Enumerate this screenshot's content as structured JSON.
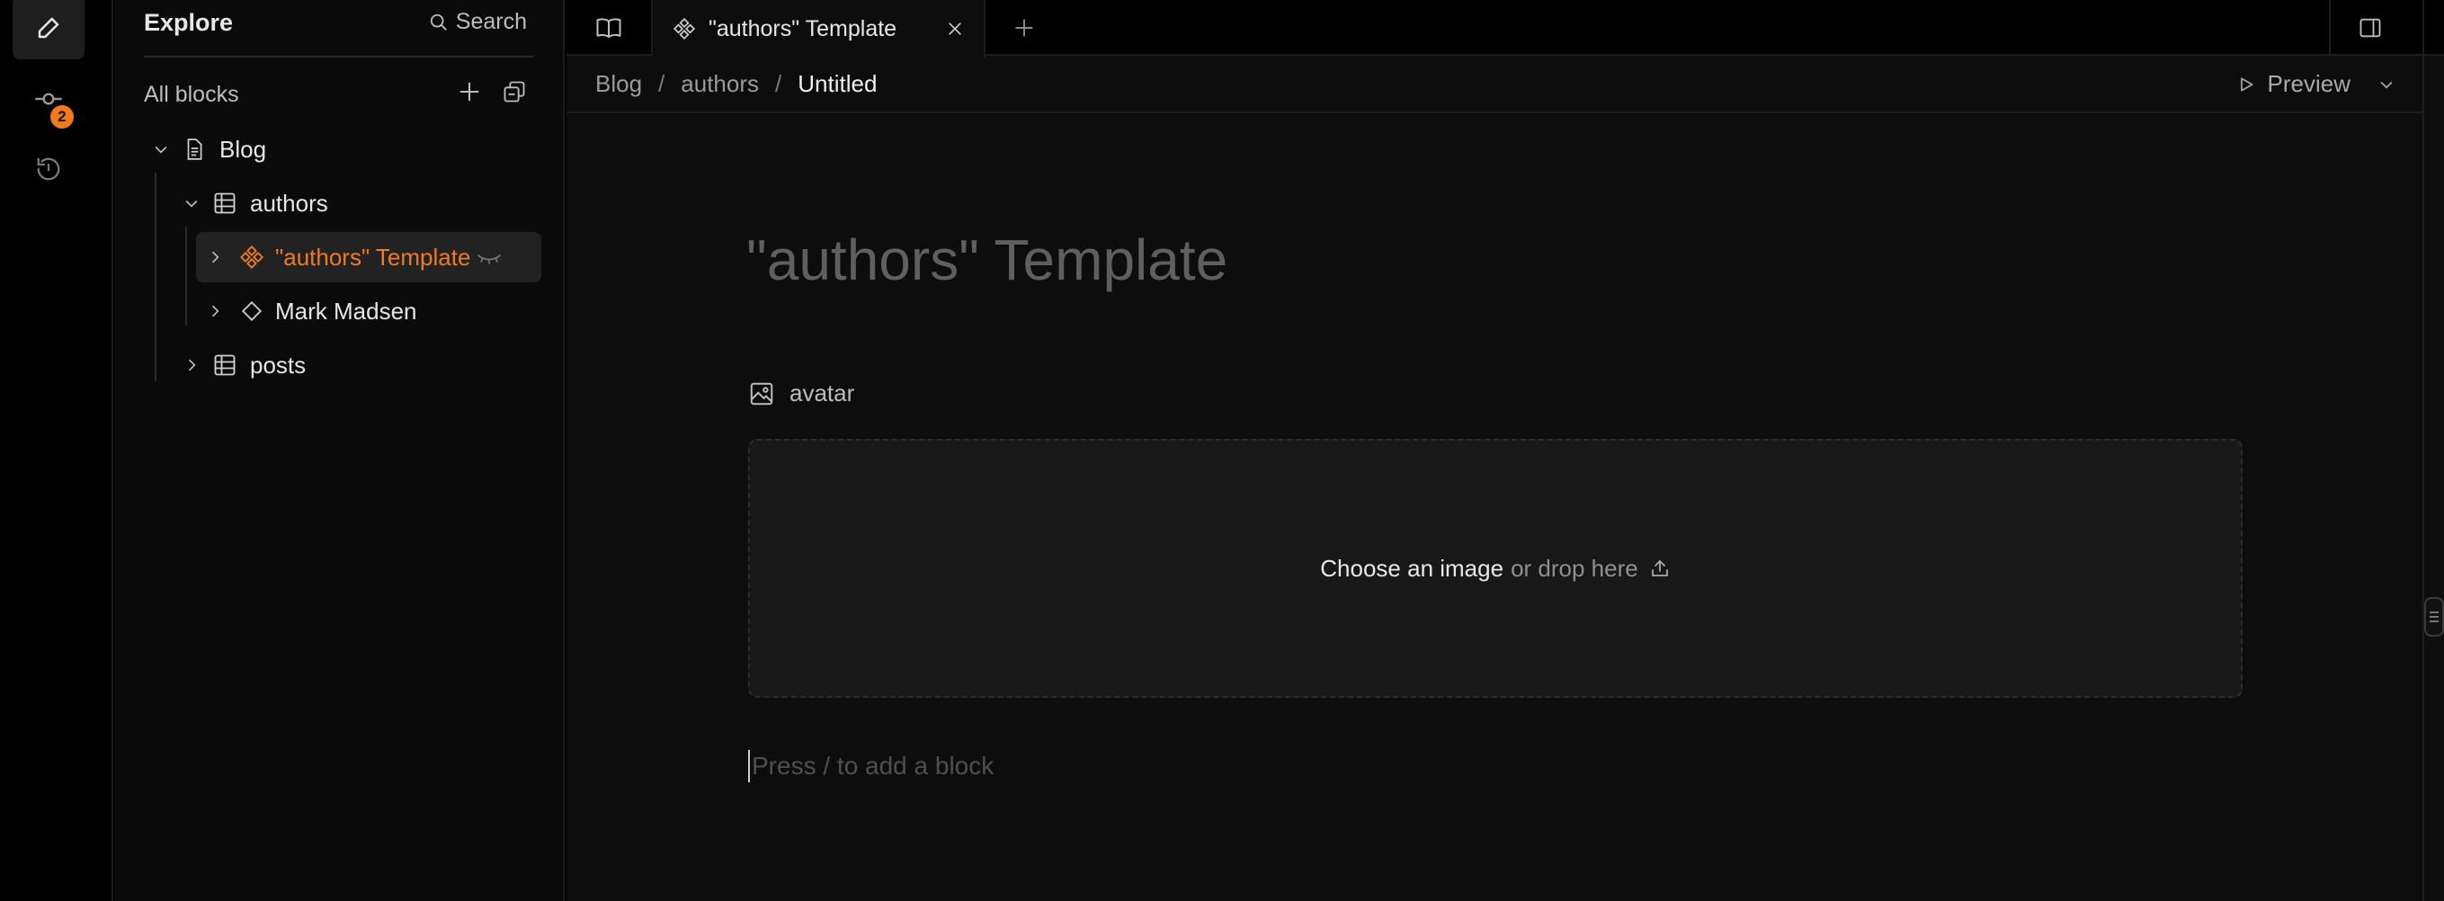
{
  "rail": {
    "badge_count": "2"
  },
  "sidebar": {
    "title": "Explore",
    "search_label": "Search",
    "section_label": "All blocks",
    "tree": {
      "blog": "Blog",
      "authors": "authors",
      "authors_template": "\"authors\" Template",
      "mark_madsen": "Mark Madsen",
      "posts": "posts"
    }
  },
  "tabs": {
    "active_label": "\"authors\" Template"
  },
  "breadcrumb": {
    "root": "Blog",
    "collection": "authors",
    "current": "Untitled",
    "separator": "/"
  },
  "toolbar": {
    "preview_label": "Preview"
  },
  "editor": {
    "title": "\"authors\" Template",
    "field_label": "avatar",
    "dropzone_primary": "Choose an image",
    "dropzone_secondary": "or drop here",
    "block_placeholder": "Press / to add a block"
  },
  "colors": {
    "accent": "#f07a22",
    "badge": "#f27a1a"
  }
}
